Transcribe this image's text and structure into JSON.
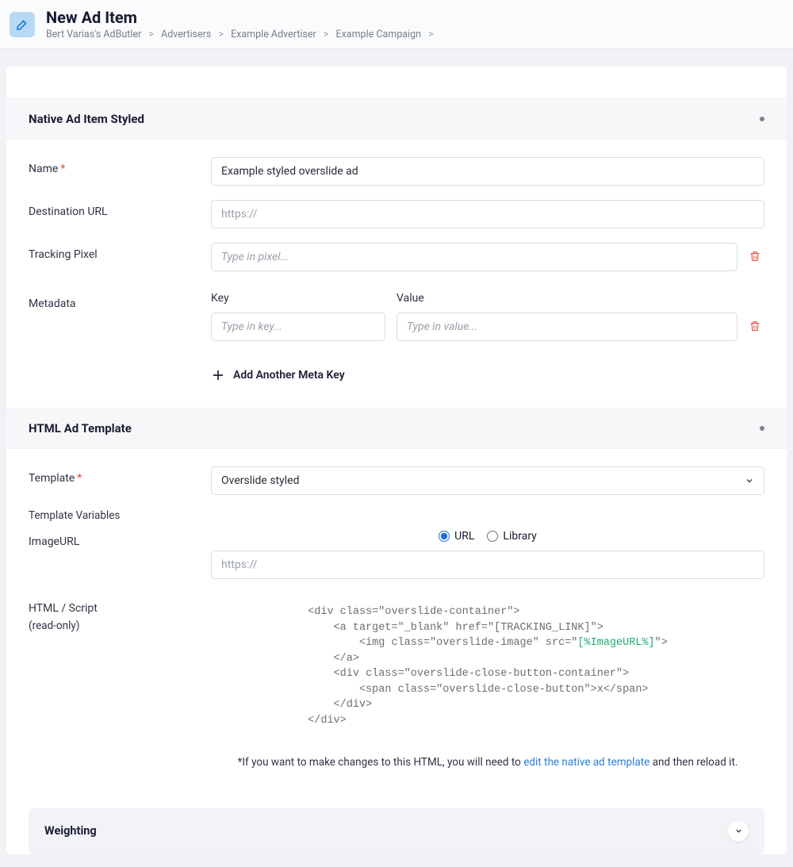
{
  "header": {
    "title": "New Ad Item",
    "breadcrumb": [
      "Bert Varias's AdButler",
      "Advertisers",
      "Example Advertiser",
      "Example Campaign"
    ]
  },
  "section_native": {
    "title": "Native Ad Item Styled",
    "fields": {
      "name_label": "Name",
      "name_value": "Example styled overslide ad",
      "dest_label": "Destination URL",
      "dest_placeholder": "https://",
      "pixel_label": "Tracking Pixel",
      "pixel_placeholder": "Type in pixel...",
      "metadata_label": "Metadata",
      "meta_key_header": "Key",
      "meta_val_header": "Value",
      "meta_key_placeholder": "Type in key...",
      "meta_val_placeholder": "Type in value...",
      "add_meta_label": "Add Another Meta Key"
    }
  },
  "section_template": {
    "title": "HTML Ad Template",
    "template_label": "Template",
    "template_selected": "Overslide styled",
    "template_vars_label": "Template Variables",
    "imageurl_label": "ImageURL",
    "radio_url": "URL",
    "radio_library": "Library",
    "imageurl_placeholder": "https://",
    "html_label": "HTML / Script",
    "html_sub": "(read-only)",
    "code_pre": "<div class=\"overslide-container\">\n    <a target=\"_blank\" href=\"[TRACKING_LINK]\">\n        <img class=\"overslide-image\" src=\"",
    "code_token": "[%ImageURL%]",
    "code_post": "\">\n    </a>\n    <div class=\"overslide-close-button-container\">\n        <span class=\"overslide-close-button\">x</span>\n    </div>\n</div>",
    "helper_pre": "*If you want to make changes to this HTML, you will need to ",
    "helper_link": "edit the native ad template",
    "helper_post": " and then reload it."
  },
  "section_weighting": {
    "title": "Weighting"
  }
}
